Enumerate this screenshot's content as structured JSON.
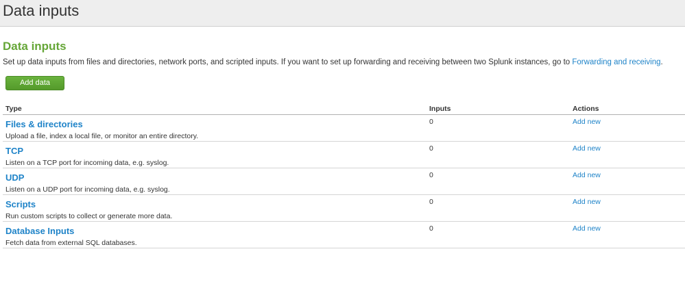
{
  "header": {
    "title": "Data inputs"
  },
  "section": {
    "title": "Data inputs",
    "description_text": "Set up data inputs from files and directories, network ports, and scripted inputs. If you want to set up forwarding and receiving between two Splunk instances, go to ",
    "description_link": "Forwarding and receiving",
    "description_end": ".",
    "add_data_label": "Add data"
  },
  "table": {
    "columns": [
      "Type",
      "Inputs",
      "Actions"
    ],
    "rows": [
      {
        "type": "Files & directories",
        "description": "Upload a file, index a local file, or monitor an entire directory.",
        "inputs": "0",
        "action": "Add new"
      },
      {
        "type": "TCP",
        "description": "Listen on a TCP port for incoming data, e.g. syslog.",
        "inputs": "0",
        "action": "Add new"
      },
      {
        "type": "UDP",
        "description": "Listen on a UDP port for incoming data, e.g. syslog.",
        "inputs": "0",
        "action": "Add new"
      },
      {
        "type": "Scripts",
        "description": "Run custom scripts to collect or generate more data.",
        "inputs": "0",
        "action": "Add new"
      },
      {
        "type": "Database Inputs",
        "description": "Fetch data from external SQL databases.",
        "inputs": "0",
        "action": "Add new"
      }
    ]
  },
  "colors": {
    "accent_green": "#65a637",
    "link_blue": "#1e83c8",
    "header_bg": "#eeeeee"
  }
}
